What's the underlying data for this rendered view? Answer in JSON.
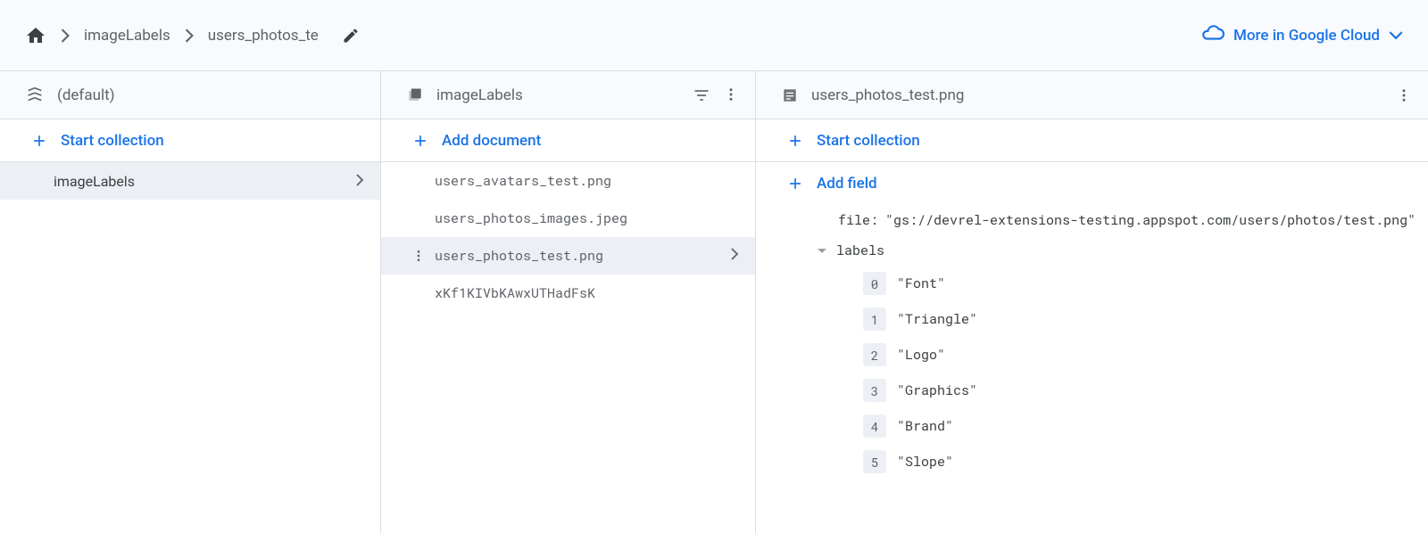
{
  "breadcrumb": {
    "items": [
      "imageLabels",
      "users_photos_te"
    ],
    "more_cloud": "More in Google Cloud"
  },
  "panel1": {
    "title": "(default)",
    "start_collection": "Start collection",
    "collections": [
      "imageLabels"
    ],
    "selected": "imageLabels"
  },
  "panel2": {
    "title": "imageLabels",
    "add_document": "Add document",
    "documents": [
      "users_avatars_test.png",
      "users_photos_images.jpeg",
      "users_photos_test.png",
      "xKf1KIVbKAwxUTHadFsK"
    ],
    "selected": "users_photos_test.png"
  },
  "panel3": {
    "title": "users_photos_test.png",
    "start_collection": "Start collection",
    "add_field": "Add field",
    "file_key": "file",
    "file_value": "\"gs://devrel-extensions-testing.appspot.com/users/photos/test.png\"",
    "labels_key": "labels",
    "labels": [
      "\"Font\"",
      "\"Triangle\"",
      "\"Logo\"",
      "\"Graphics\"",
      "\"Brand\"",
      "\"Slope\""
    ]
  }
}
